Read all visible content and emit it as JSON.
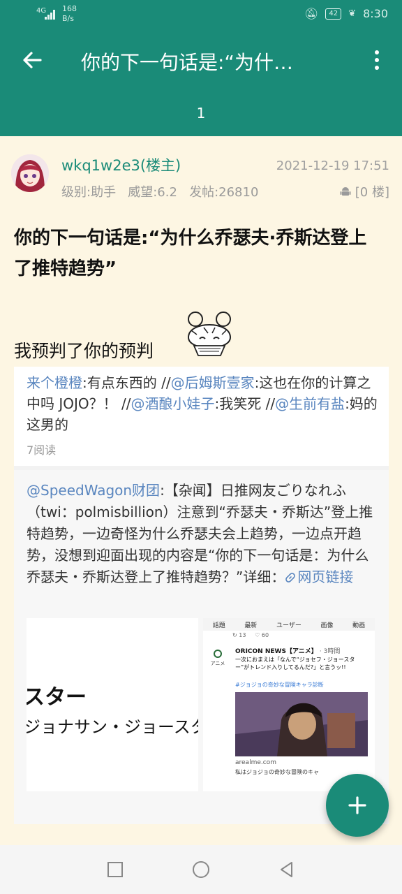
{
  "status_bar": {
    "network": "4G",
    "speed_value": "168",
    "speed_unit": "B/s",
    "battery": "42",
    "time": "8:30"
  },
  "app_bar": {
    "title": "你的下一句话是:“为什…",
    "page_number": "1"
  },
  "post": {
    "username": "wkq1w2e3(楼主)",
    "time": "2021-12-19 17:51",
    "meta": "级别:助手   威望:6.2   发帖:26810",
    "floor": "[0 楼]",
    "title": "你的下一句话是:“为什么乔瑟夫·乔斯达登上了推特趋势”",
    "text": "我预判了你的预判"
  },
  "embedded": {
    "comments": [
      {
        "user": "来个橙橙",
        "text": ":有点东西的 //"
      },
      {
        "user": "@后姆斯壹家",
        "text": ":这也在你的计算之中吗 JOJO？！ //"
      },
      {
        "user": "@酒酿小娃子",
        "text": ":我笑死 //"
      },
      {
        "user": "@生前有盐",
        "text": ":妈的这男的"
      }
    ],
    "reads": "7阅读",
    "repost_user": "@SpeedWagon财团",
    "repost_text": ":【杂闻】日推网友ごりなれふ（twi：polmisbillion）注意到“乔瑟夫・乔斯达”登上推特趋势，一边奇怪为什么乔瑟夫会上趋势，一边点开趋势，没想到迎面出现的内容是“你的下一句话是：为什么乔瑟夫・乔斯达登上了推特趋势？”详细：",
    "link_label": "网页链接",
    "image_left": {
      "line1": "スター",
      "line2": "ジョナサン・ジョースタ"
    },
    "image_right": {
      "tabs": [
        "話題",
        "最新",
        "ユーザー",
        "画像",
        "動画"
      ],
      "actions": "↻ 13     ♡ 60",
      "logo_text": "アニメ",
      "account": "ORICON NEWS【アニメ】",
      "timestamp": "· 3時間",
      "tweet_text": "一次におまえは「なんで“ジョセフ・ジョースター”がトレンド入りしてるんだ?」と言うッ!!",
      "hashtag": "#ジョジョの奇妙な冒険キャラ診断",
      "source": "arealme.com",
      "source_desc": "私はジョジョの奇妙な冒険のキャ"
    }
  },
  "colors": {
    "primary": "#1a8b78",
    "background": "#fdf6e3",
    "link": "#5a86bf"
  },
  "icons": {
    "back": "arrow-left-icon",
    "more": "more-vertical-icon",
    "fab": "plus-icon",
    "nav": [
      "square-icon",
      "circle-icon",
      "triangle-back-icon"
    ]
  }
}
